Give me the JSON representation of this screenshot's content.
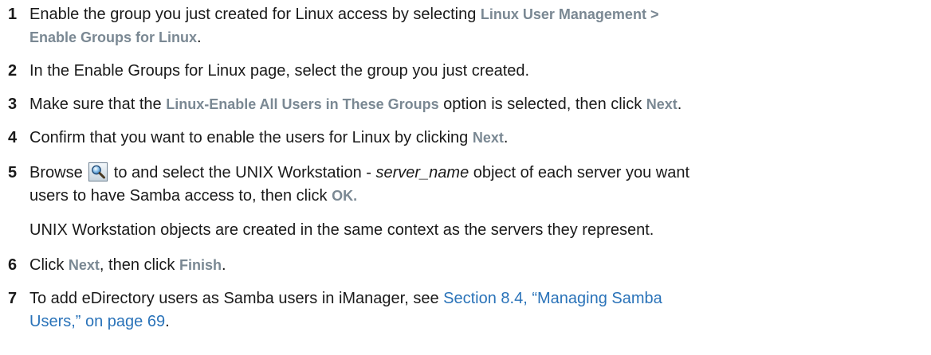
{
  "steps": [
    {
      "num": "1",
      "p1": "Enable the group you just created for Linux access by selecting ",
      "ui1": "Linux User Management >",
      "ui2": "Enable Groups for Linux",
      "p2": "."
    },
    {
      "num": "2",
      "p1": "In the Enable Groups for Linux page, select the group you just created."
    },
    {
      "num": "3",
      "p1": "Make sure that the ",
      "ui1": "Linux-Enable All Users in These Groups",
      "p2": " option is selected, then click ",
      "ui2": "Next",
      "p3": "."
    },
    {
      "num": "4",
      "p1": "Confirm that you want to enable the users for Linux by clicking ",
      "ui1": "Next",
      "p2": "."
    },
    {
      "num": "5",
      "p1": "Browse ",
      "icon": "browse-magnifier-icon",
      "p2": " to and select the UNIX Workstation - ",
      "em1": "server_name",
      "p3": " object of each server you want",
      "p4": "users to have Samba access to, then click ",
      "ui1": "OK.",
      "note": "UNIX Workstation objects are created in the same context as the servers they represent."
    },
    {
      "num": "6",
      "p1": "Click ",
      "ui1": "Next",
      "p2": ", then click ",
      "ui2": "Finish",
      "p3": "."
    },
    {
      "num": "7",
      "p1": "To add eDirectory users as Samba users in iManager, see ",
      "link1": "Section 8.4, “Managing Samba",
      "link2": "Users,” on page 69",
      "p2": "."
    }
  ],
  "colors": {
    "text": "#1a1a1a",
    "ui_label": "#7a8893",
    "link": "#2a73b9"
  }
}
